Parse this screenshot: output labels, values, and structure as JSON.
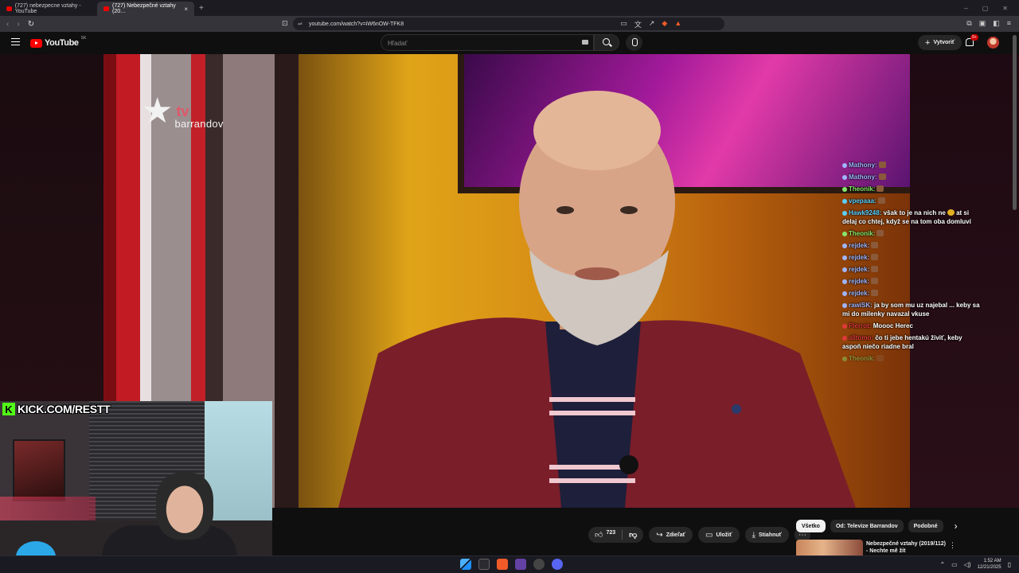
{
  "browser": {
    "tabs": [
      {
        "label": "(727) nebezpecne vztahy - YouTube"
      },
      {
        "label": "(727) Nebezpečné vztahy (20…"
      }
    ],
    "url": "youtube.com/watch?v=iW6nOW-TFK8",
    "extension_badge": "1"
  },
  "youtube": {
    "logo_text": "YouTube",
    "country_code": "SK",
    "search_placeholder": "Hľadať",
    "create_label": "Vytvoriť",
    "notification_badge": "9+"
  },
  "video": {
    "channel_logo_tv": "tv",
    "channel_logo_brand": "barrandov"
  },
  "chat": [
    {
      "user": "Mathony:",
      "text": "",
      "color": "#9fb6ff"
    },
    {
      "user": "Mathony:",
      "text": "",
      "color": "#9fb6ff"
    },
    {
      "user": "Theonik:",
      "text": "",
      "color": "#86e86a"
    },
    {
      "user": "vpepaaa:",
      "text": "",
      "color": "#5ad0ff"
    },
    {
      "user": "Hawk9248:",
      "text": "však to je na nich ne",
      "text2": "at si delaj co chtej, když se na tom oba domluví",
      "color": "#5ad0ff"
    },
    {
      "user": "Theonik:",
      "text": "",
      "color": "#86e86a"
    },
    {
      "user": "rejdek:",
      "text": "",
      "color": "#9fb6ff"
    },
    {
      "user": "rejdek:",
      "text": "",
      "color": "#9fb6ff"
    },
    {
      "user": "rejdek:",
      "text": "",
      "color": "#9fb6ff"
    },
    {
      "user": "rejdek:",
      "text": "",
      "color": "#9fb6ff"
    },
    {
      "user": "rejdek:",
      "text": "",
      "color": "#9fb6ff"
    },
    {
      "user": "rawiSK:",
      "text": "ja by som mu uz najebal ... keby sa mi do milenky navazal vkuse",
      "color": "#9fb6ff"
    },
    {
      "user": "Pierrot:",
      "text": "Moooc Herec",
      "color": "#e03a3a"
    },
    {
      "user": "alltomo:",
      "text": "čo ti jebe hentakú živiť, keby aspoň niečo riadne bral",
      "color": "#e03a3a"
    },
    {
      "user": "Theonik:",
      "text": "",
      "color": "#86e86a"
    }
  ],
  "overlay": {
    "kick_letter": "K",
    "kick_text": "KICK.COM/RESTT"
  },
  "actions": {
    "like_count": "723",
    "share_label": "Zdieľať",
    "save_label": "Uložiť",
    "download_label": "Stiahnuť"
  },
  "chips": {
    "all": "Všetko",
    "from_channel": "Od: Televize Barrandov",
    "similar": "Podobné"
  },
  "recommendation": {
    "title": "Nebezpečné vztahy (2019/112) - Nechte mě žít"
  },
  "taskbar": {
    "time": "1:52 AM",
    "date": "12/21/2025"
  }
}
